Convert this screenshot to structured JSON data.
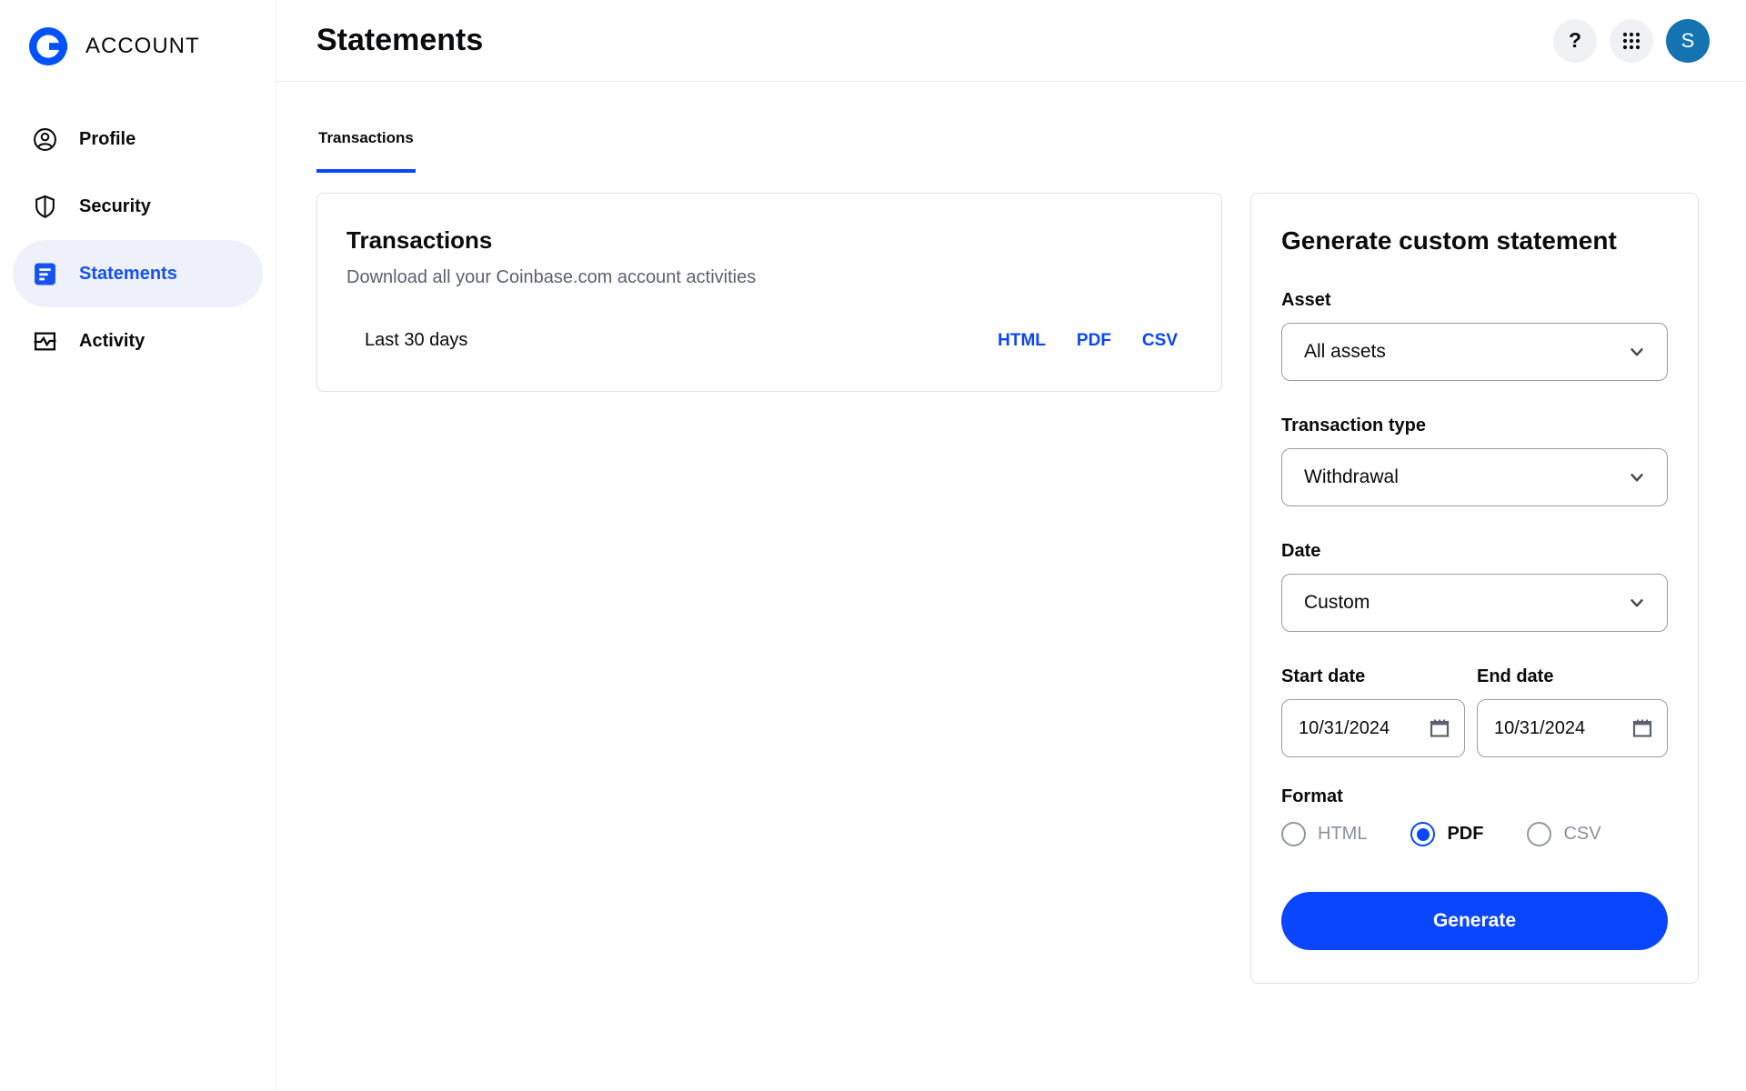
{
  "brand": {
    "name": "ACCOUNT"
  },
  "sidebar": {
    "items": [
      {
        "label": "Profile",
        "icon": "profile-icon",
        "active": false
      },
      {
        "label": "Security",
        "icon": "shield-icon",
        "active": false
      },
      {
        "label": "Statements",
        "icon": "statements-icon",
        "active": true
      },
      {
        "label": "Activity",
        "icon": "activity-icon",
        "active": false
      }
    ]
  },
  "header": {
    "title": "Statements",
    "actions": {
      "help": "?",
      "apps": "grid-icon",
      "avatar_initial": "S"
    }
  },
  "tabs": [
    {
      "label": "Transactions",
      "active": true
    }
  ],
  "transactions_card": {
    "title": "Transactions",
    "subtitle": "Download all your Coinbase.com account activities",
    "row": {
      "label": "Last 30 days",
      "links": [
        "HTML",
        "PDF",
        "CSV"
      ]
    }
  },
  "generator": {
    "title": "Generate custom statement",
    "asset": {
      "label": "Asset",
      "value": "All assets"
    },
    "transaction_type": {
      "label": "Transaction type",
      "value": "Withdrawal"
    },
    "date": {
      "label": "Date",
      "value": "Custom"
    },
    "start_date": {
      "label": "Start date",
      "value": "10/31/2024"
    },
    "end_date": {
      "label": "End date",
      "value": "10/31/2024"
    },
    "format": {
      "label": "Format",
      "options": [
        {
          "label": "HTML",
          "selected": false
        },
        {
          "label": "PDF",
          "selected": true
        },
        {
          "label": "CSV",
          "selected": false
        }
      ]
    },
    "generate_label": "Generate"
  },
  "colors": {
    "accent_blue": "#0a46fe",
    "active_nav_blue": "#1652f0",
    "active_nav_bg": "#eef0fa",
    "logo_blue": "#0052ff",
    "avatar_bg": "#1673b1",
    "secondary_text": "#5b616e",
    "border": "#e0e2e7",
    "input_border": "#989da6"
  }
}
